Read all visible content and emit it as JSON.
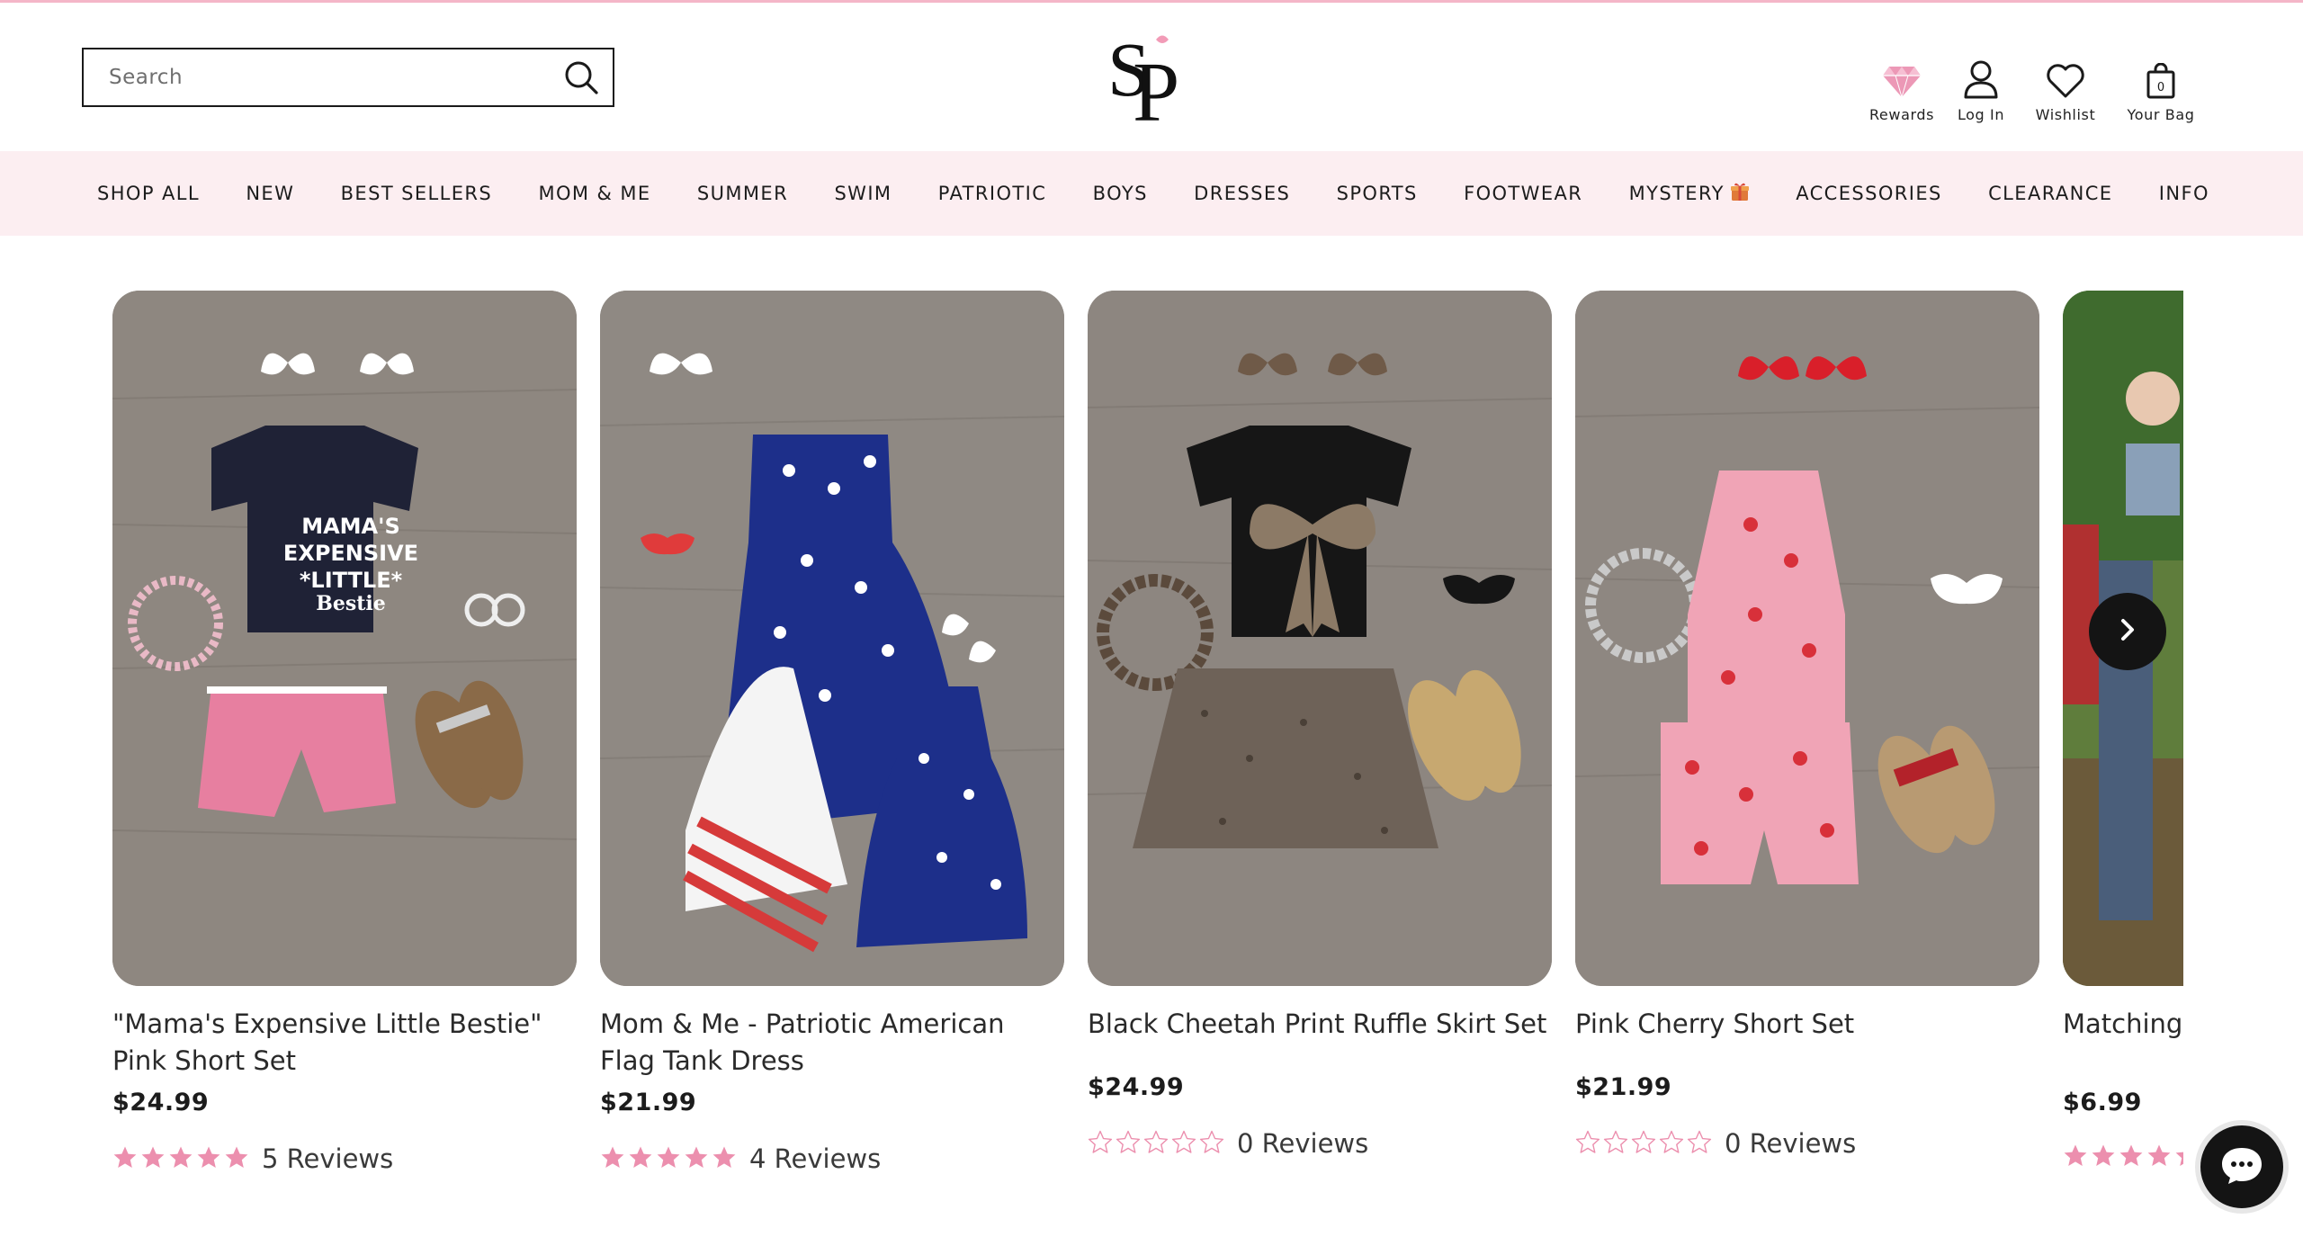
{
  "colors": {
    "accent_pink": "#f4b6c8",
    "nav_bg": "#fceef1",
    "star_pink": "#ec8fae",
    "ink": "#1c1c1c"
  },
  "header": {
    "search": {
      "placeholder": "Search",
      "icon": "search-icon"
    },
    "logo": {
      "icon": "sp-monogram-logo"
    },
    "icons": [
      {
        "id": "rewards",
        "label": "Rewards",
        "icon": "diamond-icon"
      },
      {
        "id": "login",
        "label": "Log In",
        "icon": "user-icon"
      },
      {
        "id": "wishlist",
        "label": "Wishlist",
        "icon": "heart-icon"
      },
      {
        "id": "bag",
        "label": "Your Bag",
        "icon": "bag-icon",
        "count": "0"
      }
    ]
  },
  "nav": {
    "items": [
      "SHOP ALL",
      "NEW",
      "BEST SELLERS",
      "MOM & ME",
      "SUMMER",
      "SWIM",
      "PATRIOTIC",
      "BOYS",
      "DRESSES",
      "SPORTS",
      "FOOTWEAR",
      "MYSTERY",
      "ACCESSORIES",
      "CLEARANCE",
      "INFO"
    ],
    "mystery_icon": "gift-icon"
  },
  "products": [
    {
      "title": "\"Mama's Expensive Little Bestie\" Pink Short Set",
      "price": "$24.99",
      "rating": 5,
      "reviews": "5 Reviews"
    },
    {
      "title": "Mom & Me - Patriotic American Flag Tank Dress",
      "price": "$21.99",
      "rating": 5,
      "reviews": "4 Reviews"
    },
    {
      "title": "Black Cheetah Print Ruffle Skirt Set",
      "price": "$24.99",
      "rating": 0,
      "reviews": "0 Reviews"
    },
    {
      "title": "Pink Cherry Short Set",
      "price": "$21.99",
      "rating": 0,
      "reviews": "0 Reviews"
    },
    {
      "title": "Matching Camo/Flo",
      "price": "$6.99",
      "rating": 5,
      "reviews": ""
    }
  ],
  "shirt_print": [
    "MAMA'S",
    "EXPENSIVE",
    "*LITTLE*",
    "Bestie"
  ],
  "carousel": {
    "next_icon": "chevron-right-icon"
  },
  "chat": {
    "icon": "chat-bubble-icon"
  }
}
